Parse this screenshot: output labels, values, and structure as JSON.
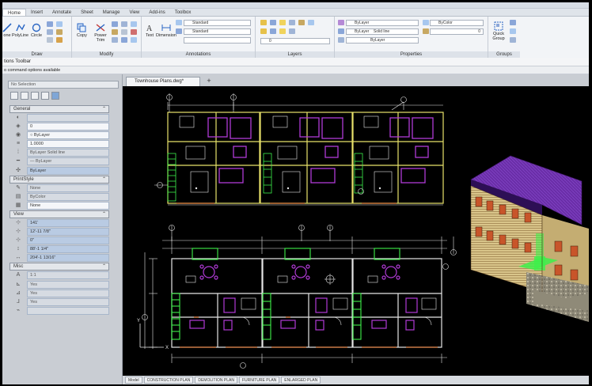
{
  "ribbon": {
    "tabs": [
      "Home",
      "Insert",
      "Annotate",
      "Sheet",
      "Manage",
      "View",
      "Add-ins",
      "Toolbox"
    ],
    "active_tab": "Home",
    "panels": {
      "draw": {
        "title": "Draw",
        "tools": [
          "one",
          "PolyLine",
          "Circle"
        ]
      },
      "modify": {
        "title": "Modify",
        "tools": [
          "Copy",
          "Power Trim"
        ]
      },
      "annotations": {
        "title": "Annotations",
        "tools": [
          "Text",
          "Dimension"
        ],
        "styles": [
          "Standard",
          "Standard"
        ]
      },
      "layers": {
        "title": "Layers",
        "current_value": "0"
      },
      "properties": {
        "title": "Properties",
        "color": "ByLayer",
        "linetype": "ByLayer",
        "linetype_detail": "Solid line",
        "lineweight": "ByLayer",
        "plot_style": "ByColor",
        "transparency": "0"
      },
      "groups": {
        "title": "Groups",
        "tools": [
          "Quick Group"
        ]
      }
    }
  },
  "toolbar_strip": {
    "label": "tions Toolbar"
  },
  "command_strip": {
    "label": "o command options available"
  },
  "properties_panel": {
    "selection": "No Selection",
    "sections": {
      "general": {
        "label": "General",
        "rows": [
          "",
          "0",
          "ByLayer",
          "1.0000",
          "ByLayer   Solid line",
          "ByLayer",
          "ByLayer"
        ]
      },
      "printstyle": {
        "label": "PrintStyle",
        "rows": [
          "None",
          "ByColor",
          "None"
        ]
      },
      "view": {
        "label": "View",
        "rows": [
          "141'",
          "12'-11 7/8\"",
          "0\"",
          "88'-1 1/4\"",
          "204'-1 13/16\""
        ]
      },
      "misc": {
        "label": "Misc",
        "rows": [
          "1:1",
          "Yes",
          "Yes",
          "Yes",
          ""
        ]
      }
    }
  },
  "document": {
    "tab_label": "Townhouse Plans.dwg*",
    "new_tab_symbol": "+"
  },
  "layout_tabs": [
    "Model",
    "CONSTRUCTION PLAN",
    "DEMOLITION PLAN",
    "FURNITURE PLAN",
    "ENLARGED PLAN"
  ],
  "colors": {
    "canvas_bg": "#000000",
    "wall_yellow": "#e8e36a",
    "line_white": "#e6e6e6",
    "magenta": "#b03ad6",
    "green": "#3df04a",
    "orange": "#d8783c",
    "roof_purple": "#6a2ea8"
  }
}
